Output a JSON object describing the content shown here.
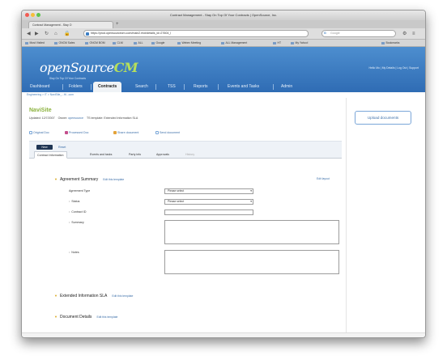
{
  "window": {
    "title": "Contract Management - Stay On Top Of Your Contracts | OpenSource, Inc."
  },
  "browser": {
    "tab_label": "Contract Management - Stay O",
    "url": "https://prod.opensourcecm.com/main2.rfc#/details_id=27604_l",
    "search_placeholder": "Google",
    "bookmarks": [
      "Most Visited",
      "ONCM Sales",
      "ONCM BOM",
      "CLM",
      "ALL",
      "Google",
      "Webex Meeting",
      "ALL Management",
      "HT",
      "My Yahoo!",
      "Bookmarks"
    ]
  },
  "app": {
    "logo_main": "openSource",
    "logo_accent": "CM",
    "tagline": "Stay On Top Of Your Contracts",
    "user_links": "Hello Mo | My Details | Log Out | Support",
    "nav": [
      {
        "label": "Dashboard",
        "active": false
      },
      {
        "label": "Folders",
        "active": false
      },
      {
        "label": "Contracts",
        "active": true
      },
      {
        "label": "Search",
        "active": false
      },
      {
        "label": "TSS",
        "active": false
      },
      {
        "label": "Reports",
        "active": false
      },
      {
        "label": "Events and Tasks",
        "active": false
      },
      {
        "label": "Admin",
        "active": false
      }
    ],
    "breadcrumb": "Engineering > IT > NaviSite_...ftl...com"
  },
  "record": {
    "title": "NaviSite",
    "updated_label": "Updated: 12/7/2007",
    "owner_label": "Owner:",
    "owner_value": "opensource",
    "ts_template": "TS template: Extended Information SLA"
  },
  "doc_links": [
    "Original Doc",
    "Processed Doc",
    "Share document",
    "Send document"
  ],
  "actions": {
    "new_label": "New",
    "reset_label": "Reset"
  },
  "tabs": [
    {
      "label": "Contract Information",
      "active": true
    },
    {
      "label": "Events and tasks",
      "active": false
    },
    {
      "label": "Party info",
      "active": false
    },
    {
      "label": "Approvals",
      "active": false
    },
    {
      "label": "History",
      "active": false,
      "dim": true
    }
  ],
  "sections": {
    "agreement_summary": "Agreement Summary",
    "edit_template": "Edit this template",
    "edit_layout": "Edit layout",
    "extended_info": "Extended Information SLA",
    "document_details": "Document Details"
  },
  "fields": {
    "agreement_type_label": "Agreement Type",
    "agreement_type_value": "Please select",
    "status_label": "Status",
    "status_value": "Please select",
    "contract_id_label": "Contract ID",
    "summary_label": "Summary",
    "notes_label": "Notes"
  },
  "sidebar": {
    "upload_label": "Upload documents"
  }
}
